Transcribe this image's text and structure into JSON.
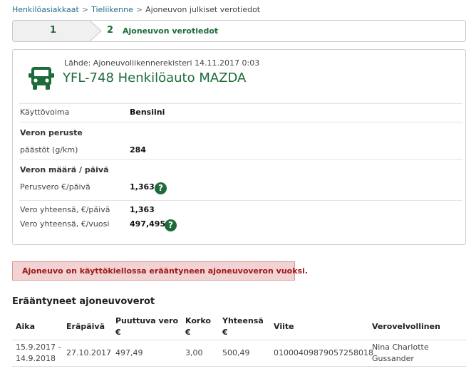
{
  "breadcrumb": {
    "items": [
      "Henkilöasiakkaat",
      "Tieliikenne"
    ],
    "separator": ">",
    "current": "Ajoneuvon julkiset verotiedot"
  },
  "stepper": {
    "step1": {
      "number": "1"
    },
    "step2": {
      "number": "2",
      "label": "Ajoneuvon verotiedot"
    }
  },
  "vehicle": {
    "source": "Lähde: Ajoneuvoliikennerekisteri 14.11.2017 0:03",
    "title": "YFL-748 Henkilöauto MAZDA",
    "icon": "car-icon",
    "rows": {
      "power_label": "Käyttövoima",
      "power_value": "Bensiini",
      "basis_heading": "Veron peruste",
      "emissions_label": "päästöt (g/km)",
      "emissions_value": "284",
      "amount_heading": "Veron määrä / päivä",
      "base_tax_label": "Perusvero €/päivä",
      "base_tax_value": "1,363",
      "total_day_label": "Vero yhteensä, €/päivä",
      "total_day_value": "1,363",
      "total_year_label": "Vero yhteensä, €/vuosi",
      "total_year_value": "497,495"
    },
    "help_glyph": "?"
  },
  "alert": {
    "text": "Ajoneuvo on käyttökiellossa erääntyneen ajoneuvoveron vuoksi."
  },
  "overdue": {
    "title": "Erääntyneet ajoneuvoverot",
    "headers": {
      "period": "Aika",
      "due": "Eräpäivä",
      "missing_1": "Puuttuva vero",
      "missing_2": "€",
      "interest_1": "Korko",
      "interest_2": "€",
      "total_1": "Yhteensä",
      "total_2": "€",
      "reference": "Viite",
      "taxpayer": "Verovelvollinen"
    },
    "rows": [
      {
        "period_1": "15.9.2017 -",
        "period_2": "14.9.2018",
        "due": "27.10.2017",
        "missing": "497,49",
        "interest": "3,00",
        "total": "500,49",
        "reference": "01000409879057258018",
        "taxpayer_1": "Nina Charlotte",
        "taxpayer_2": "Gussander"
      }
    ]
  },
  "colors": {
    "accent_green": "#1e6b3a",
    "link_blue": "#1f6f8b",
    "alert_bg": "#f2d3d3",
    "alert_text": "#a01818"
  }
}
